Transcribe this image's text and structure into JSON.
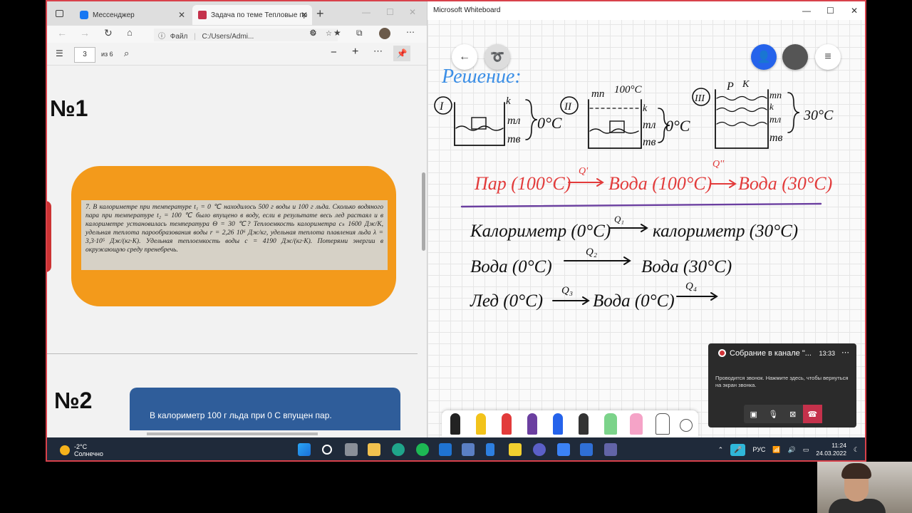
{
  "browser": {
    "tabs": [
      {
        "label": "Мессенджер"
      },
      {
        "label": "Задача по теме Тепловые пр..."
      }
    ],
    "address_prefix": "Файл",
    "address": "C:/Users/Admi...",
    "pdf_page": "3",
    "pdf_total": "из 6",
    "heading1": "№1",
    "problem_text": "7. В калориметре при температуре t₁ = 0 ℃ находилось 500 г воды и 100 г льда. Сколько водяного пара при температуре t₂ = 100 ℃ было впущено в воду, если в результате весь лед растаял и в калориметре установилась температура Θ = 30 ℃? Теплоемкость калориметра cₖ 1600 Дж/К, удельная теплота парообразования воды r = 2,26 10⁶ Дж/кг, удельная теплота плавления льда λ = 3,3·10⁵ Дж/(кг·К). Удельная теплоемкость воды c = 4190 Дж/(кг·К). Потерями энергии в окружающую среду пренебречь.",
    "heading2": "№2",
    "card_text": "В калориметр 100 г льда при 0 С впущен пар."
  },
  "whiteboard": {
    "title": "Microsoft Whiteboard",
    "ink": {
      "title": "Решение:",
      "roman": [
        "I",
        "II",
        "III"
      ],
      "labels1": [
        "k",
        "mл",
        "mв",
        "0°C"
      ],
      "labels2": [
        "mп",
        "100°C",
        "k",
        "mл",
        "mв",
        "0°C"
      ],
      "labels3": [
        "P",
        "K",
        "mп",
        "k",
        "mл",
        "mв",
        "30°C"
      ],
      "chain_red": [
        "Пар (100°C)",
        "Q'",
        "Вода (100°C)",
        "Q''",
        "Вода (30°C)"
      ],
      "line1": [
        "Калориметр (0°C)",
        "Q₁",
        "калориметр (30°C)"
      ],
      "line2": [
        "Вода (0°C)",
        "Q₂",
        "Вода (30°C)"
      ],
      "line3": [
        "Лед (0°C)",
        "Q₃",
        "Вода (0°C)",
        "Q₄"
      ]
    }
  },
  "teams": {
    "title": "Собрание в канале \"...",
    "time": "13:33",
    "message": "Проводится звонок. Нажмите здесь, чтобы вернуться на экран звонка."
  },
  "taskbar": {
    "temp": "-2°C",
    "weather": "Солнечно",
    "lang": "РУС",
    "time": "11:24",
    "date": "24.03.2022"
  },
  "colors": {
    "accent_red": "#d8414b",
    "ink_blue": "#3a8ee6",
    "ink_red": "#e23b3b",
    "ink_purple": "#6b3fa0",
    "ink_black": "#111111"
  }
}
